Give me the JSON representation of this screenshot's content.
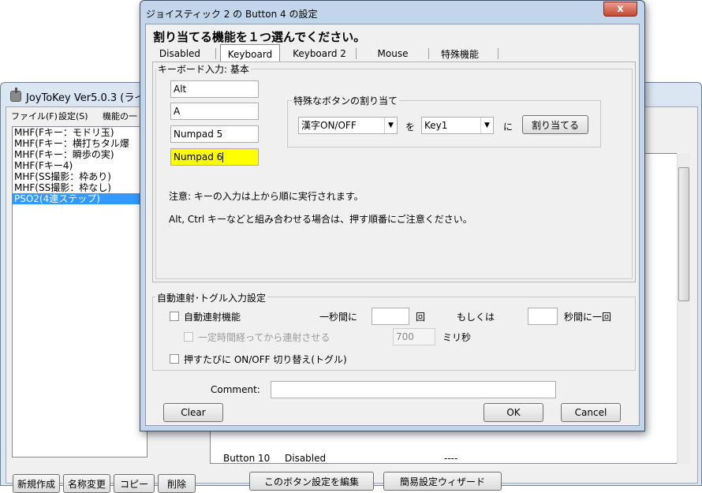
{
  "main_window": {
    "title": "JoyToKey Ver5.0.3 (ライ",
    "menu": [
      "ファイル(F)",
      "設定(S)",
      "機能の一"
    ],
    "profiles": [
      "MHF(Fキー：モドリ玉)",
      "MHF(Fキー：横打ちタル爆",
      "MHF(Fキー：瞬歩の実)",
      "MHF(Fキー4)",
      "MHF(SS撮影：枠あり)",
      "MHF(SS撮影：枠なし)",
      "PSO2(4連ステップ)"
    ],
    "selected_profile_index": 6,
    "bottom_buttons": {
      "new": "新規作成",
      "rename": "名称変更",
      "copy": "コピー",
      "delete": "削除"
    },
    "list_partial_row": {
      "button": "Button 10",
      "assign": "Disabled",
      "value": "----"
    },
    "edit_button": "このボタン設定を編集",
    "wizard_button": "簡易設定ウィザード"
  },
  "dialog": {
    "title": "ジョイスティック 2 の Button 4 の設定",
    "close_label": "x",
    "heading": "割り当てる機能を１つ選んでください。",
    "tabs": [
      "Disabled",
      "Keyboard",
      "Keyboard 2",
      "Mouse",
      "特殊機能"
    ],
    "active_tab_index": 1,
    "keyboard_group_label": "キーボード入力: 基本",
    "key_fields": [
      "Alt",
      "A",
      "Numpad 5",
      "Numpad 6"
    ],
    "special_group_label": "特殊なボタンの割り当て",
    "special_combo_1": "漢字ON/OFF",
    "special_wo": "を",
    "special_combo_2": "Key1",
    "special_ni": "に",
    "assign_button": "割り当てる",
    "note_1": "注意: キーの入力は上から順に実行されます。",
    "note_2": "Alt, Ctrl キーなどと組み合わせる場合は、押す順番にご注意ください。",
    "auto_group_label": "自動連射･トグル入力設定",
    "auto_fire_label": "自動連射機能",
    "per_second_label": "一秒間に",
    "times_label": "回",
    "or_label": "もしくは",
    "seconds_per_label": "秒間に一回",
    "delay_label": "一定時間経ってから連射させる",
    "delay_value": "700",
    "ms_label": "ミリ秒",
    "toggle_label": "押すたびに ON/OFF 切り替え(トグル)",
    "comment_label": "Comment:",
    "comment_value": "",
    "clear_button": "Clear",
    "ok_button": "OK",
    "cancel_button": "Cancel"
  },
  "colors": {
    "active_field": "#ffff00",
    "selection": "#3399ff",
    "frame": "#c3d5ea"
  }
}
